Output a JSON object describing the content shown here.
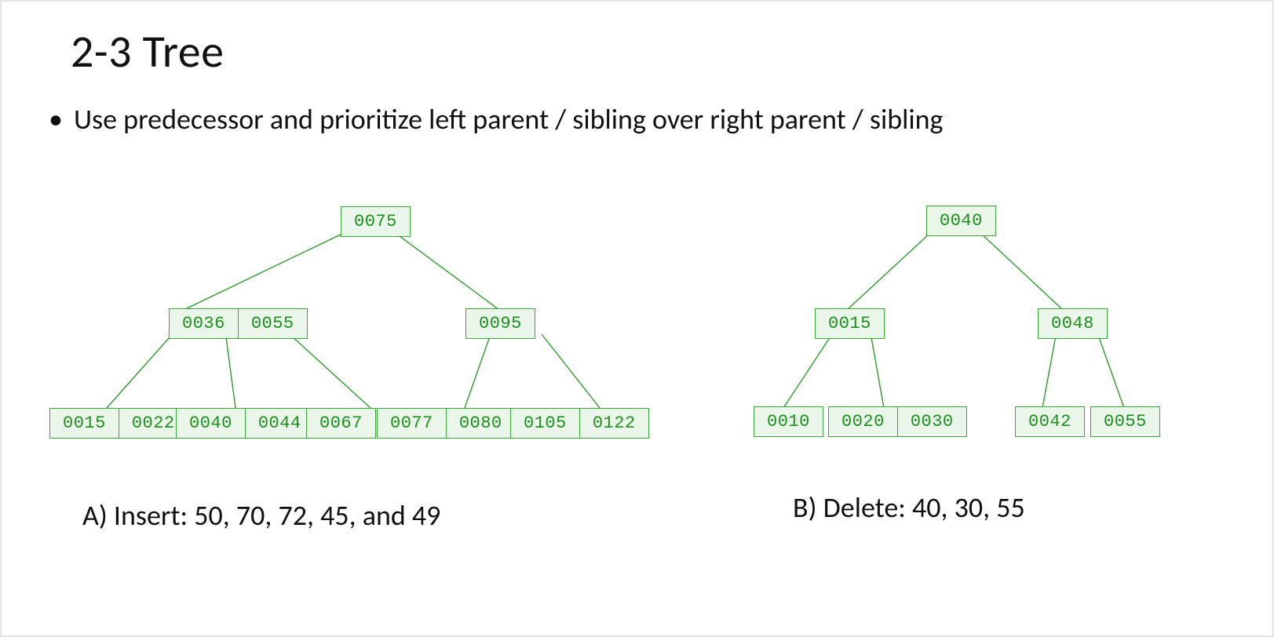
{
  "title": "2-3 Tree",
  "bullet": "Use predecessor and prioritize left parent / sibling over right parent / sibling",
  "captionA": "A) Insert: 50, 70, 72, 45, and 49",
  "captionB": "B) Delete: 40, 30, 55",
  "treeA": {
    "root": [
      "0075"
    ],
    "mid": {
      "m0": [
        "0036",
        "0055"
      ],
      "m1": [
        "0095"
      ]
    },
    "leaf": {
      "l0": [
        "0015",
        "0022"
      ],
      "l1": [
        "0040",
        "0044"
      ],
      "l2": [
        "0067"
      ],
      "l3": [
        "0077",
        "0080"
      ],
      "l4": [
        "0105",
        "0122"
      ]
    }
  },
  "treeB": {
    "root": [
      "0040"
    ],
    "mid": {
      "m0": [
        "0015"
      ],
      "m1": [
        "0048"
      ]
    },
    "leaf": {
      "l0": [
        "0010"
      ],
      "l1": [
        "0020",
        "0030"
      ],
      "l2": [
        "0042"
      ],
      "l3": [
        "0055"
      ]
    }
  }
}
